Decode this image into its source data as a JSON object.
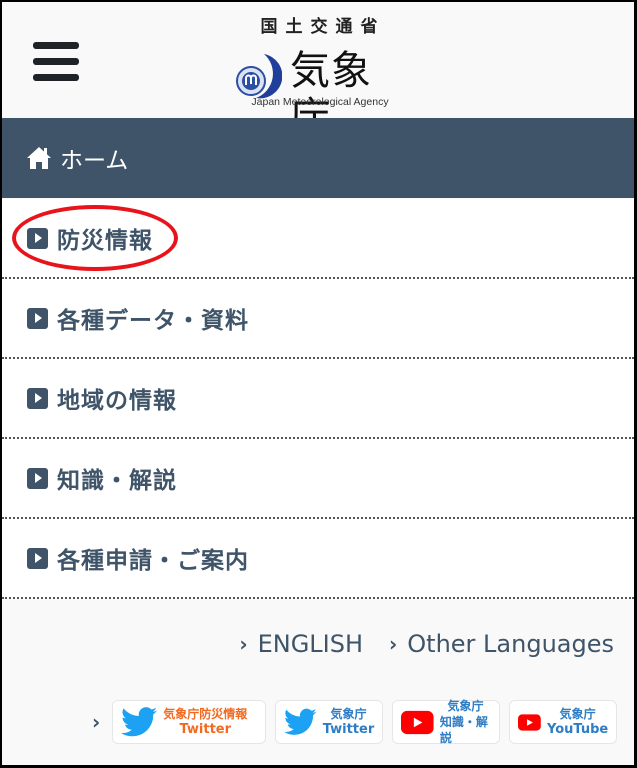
{
  "header": {
    "ministry": "国土交通省",
    "agency_name_jp": "気象庁",
    "agency_name_en": "Japan Meteorological Agency",
    "menu_icon": "hamburger-menu-icon"
  },
  "nav": {
    "home_icon": "home-icon",
    "home_label": "ホーム"
  },
  "menu": {
    "items": [
      {
        "label": "防災情報",
        "icon": "play-square-icon",
        "highlighted": true
      },
      {
        "label": "各種データ・資料",
        "icon": "play-square-icon"
      },
      {
        "label": "地域の情報",
        "icon": "play-square-icon"
      },
      {
        "label": "知識・解説",
        "icon": "play-square-icon"
      },
      {
        "label": "各種申請・ご案内",
        "icon": "play-square-icon"
      }
    ]
  },
  "languages": [
    {
      "label": "ENGLISH",
      "icon": "chevron-right-icon"
    },
    {
      "label": "Other Languages",
      "icon": "chevron-right-icon"
    }
  ],
  "social": [
    {
      "line1": "気象庁防災情報",
      "line2": "Twitter",
      "icon": "twitter-bird-icon",
      "color": "#f26a21"
    },
    {
      "line1": "気象庁",
      "line2": "Twitter",
      "icon": "twitter-bird-icon",
      "color": "#2c7cc6"
    },
    {
      "line1": "気象庁",
      "line2": "知識・解説",
      "icon": "youtube-play-icon",
      "color": "#2c7cc6"
    },
    {
      "line1": "気象庁",
      "line2": "YouTube",
      "icon": "youtube-play-icon",
      "color": "#2c7cc6"
    }
  ],
  "colors": {
    "nav_bg": "#3f5468",
    "highlight_ring": "#e8141b",
    "twitter_blue": "#1da1f2",
    "youtube_red": "#ff0000"
  }
}
